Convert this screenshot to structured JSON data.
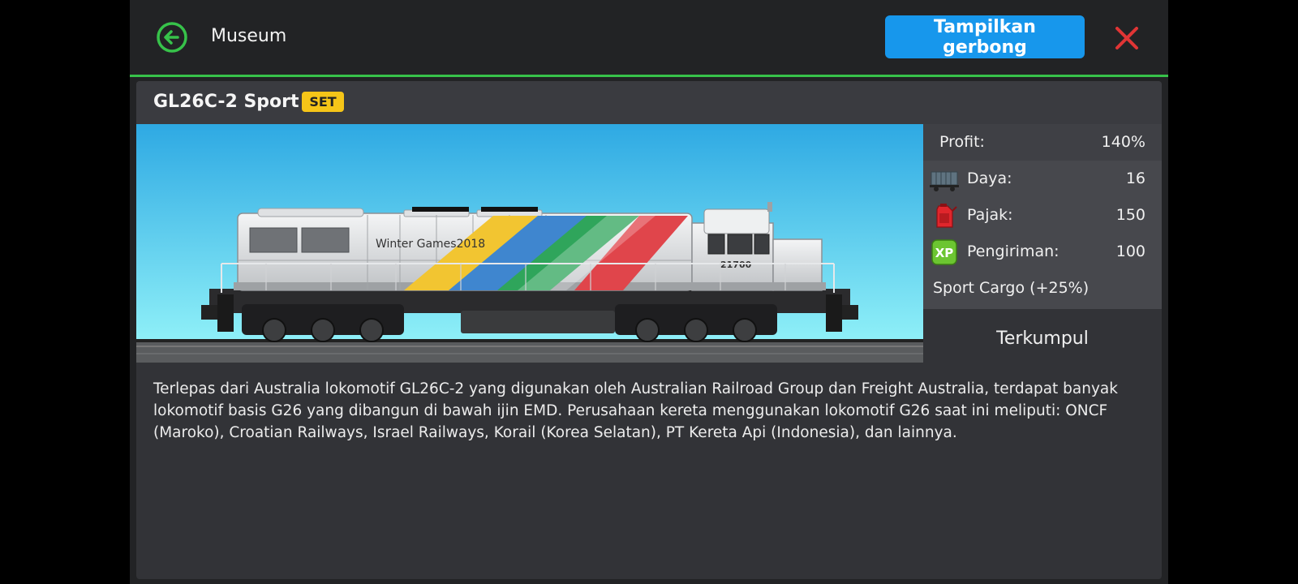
{
  "header": {
    "title": "Museum",
    "show_wagons_label": "Tampilkan gerbong"
  },
  "locomotive": {
    "name": "GL26C-2 Sport",
    "badge": "SET",
    "livery_text": "Winter Games2018",
    "number": "21700"
  },
  "stats": {
    "profit": {
      "label": "Profit:",
      "value": "140%"
    },
    "power": {
      "label": "Daya:",
      "value": "16",
      "icon": "wagon-icon"
    },
    "tax": {
      "label": "Pajak:",
      "value": "150",
      "icon": "fuel-can-icon"
    },
    "shipping": {
      "label": "Pengiriman:",
      "value": "100",
      "icon": "xp-icon",
      "icon_text": "XP"
    },
    "bonus": "Sport Cargo (+25%)"
  },
  "collected_label": "Terkumpul",
  "description": "Terlepas dari Australia lokomotif GL26C-2 yang digunakan oleh Australian Railroad Group dan Freight Australia, terdapat banyak lokomotif basis G26 yang dibangun di bawah ijin EMD. Perusahaan kereta menggunakan lokomotif G26 saat ini meliputi: ONCF (Maroko), Croatian Railways, Israel Railways, Korail (Korea Selatan), PT Kereta Api (Indonesia), dan lainnya.",
  "colors": {
    "accent_green": "#37c24a",
    "button_blue": "#1797ec",
    "close_red": "#e03535",
    "badge_yellow": "#f5c518"
  }
}
